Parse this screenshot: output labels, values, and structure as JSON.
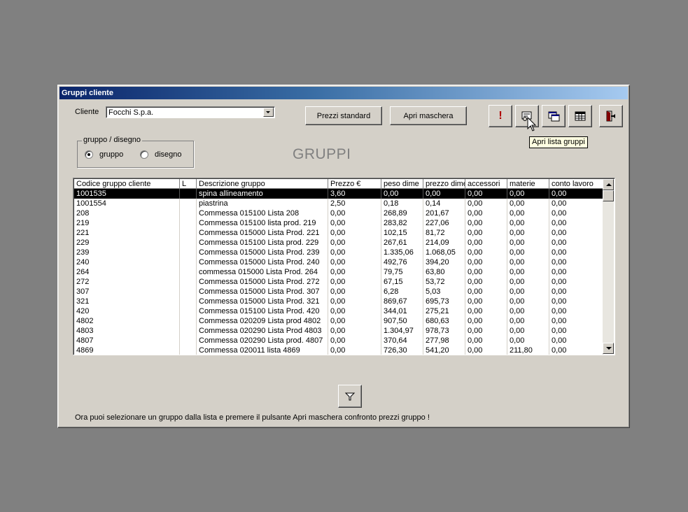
{
  "window": {
    "title": "Gruppi cliente"
  },
  "cliente": {
    "label": "Cliente",
    "value": "Focchi S.p.a."
  },
  "buttons": {
    "prezzi_standard": "Prezzi standard",
    "apri_maschera": "Apri maschera"
  },
  "toolbar": {
    "alert": {
      "icon": "exclamation-icon",
      "glyph": "!"
    },
    "open_groups": {
      "icon": "open-groups-icon"
    },
    "windows": {
      "icon": "windows-icon"
    },
    "table": {
      "icon": "table-icon"
    },
    "exit": {
      "icon": "exit-door-icon"
    }
  },
  "tooltip": "Apri lista gruppi",
  "group_option": {
    "legend": "gruppo / disegno",
    "options": [
      "gruppo",
      "disegno"
    ],
    "selected": "gruppo"
  },
  "heading": "GRUPPI",
  "table": {
    "columns": [
      "Codice gruppo cliente",
      "L",
      "Descrizione gruppo",
      "Prezzo €",
      "peso dime",
      "prezzo dime",
      "accessori",
      "materie",
      "conto lavoro"
    ],
    "selected_row": 0,
    "rows": [
      [
        "1001535",
        "",
        "spina allineamento",
        "3,60",
        "0,00",
        "0,00",
        "0,00",
        "0,00",
        "0,00"
      ],
      [
        "1001554",
        "",
        "piastrina",
        "2,50",
        "0,18",
        "0,14",
        "0,00",
        "0,00",
        "0,00"
      ],
      [
        "208",
        "",
        "Commessa 015100 Lista 208",
        "0,00",
        "268,89",
        "201,67",
        "0,00",
        "0,00",
        "0,00"
      ],
      [
        "219",
        "",
        "Commessa 015100 lista prod. 219",
        "0,00",
        "283,82",
        "227,06",
        "0,00",
        "0,00",
        "0,00"
      ],
      [
        "221",
        "",
        "Commessa 015000 Lista Prod. 221",
        "0,00",
        "102,15",
        "81,72",
        "0,00",
        "0,00",
        "0,00"
      ],
      [
        "229",
        "",
        "Commessa 015100 Lista prod. 229",
        "0,00",
        "267,61",
        "214,09",
        "0,00",
        "0,00",
        "0,00"
      ],
      [
        "239",
        "",
        "Commessa 015000 Lista Prod. 239",
        "0,00",
        "1.335,06",
        "1.068,05",
        "0,00",
        "0,00",
        "0,00"
      ],
      [
        "240",
        "",
        "Commessa 015000 Lista Prod. 240",
        "0,00",
        "492,76",
        "394,20",
        "0,00",
        "0,00",
        "0,00"
      ],
      [
        "264",
        "",
        "commessa 015000 Lista Prod. 264",
        "0,00",
        "79,75",
        "63,80",
        "0,00",
        "0,00",
        "0,00"
      ],
      [
        "272",
        "",
        "Commessa 015000 Lista Prod. 272",
        "0,00",
        "67,15",
        "53,72",
        "0,00",
        "0,00",
        "0,00"
      ],
      [
        "307",
        "",
        "Commessa 015000 Lista Prod. 307",
        "0,00",
        "6,28",
        "5,03",
        "0,00",
        "0,00",
        "0,00"
      ],
      [
        "321",
        "",
        "Commessa 015000 Lista Prod. 321",
        "0,00",
        "869,67",
        "695,73",
        "0,00",
        "0,00",
        "0,00"
      ],
      [
        "420",
        "",
        "Commessa 015100 Lista Prod. 420",
        "0,00",
        "344,01",
        "275,21",
        "0,00",
        "0,00",
        "0,00"
      ],
      [
        "4802",
        "",
        "Commessa 020209 Lista prod 4802",
        "0,00",
        "907,50",
        "680,63",
        "0,00",
        "0,00",
        "0,00"
      ],
      [
        "4803",
        "",
        "Commessa 020290 Lista Prod 4803",
        "0,00",
        "1.304,97",
        "978,73",
        "0,00",
        "0,00",
        "0,00"
      ],
      [
        "4807",
        "",
        "Commessa 020290 Lista prod. 4807",
        "0,00",
        "370,64",
        "277,98",
        "0,00",
        "0,00",
        "0,00"
      ],
      [
        "4869",
        "",
        "Commessa 020011 lista 4869",
        "0,00",
        "726,30",
        "541,20",
        "0,00",
        "211,80",
        "0,00"
      ]
    ]
  },
  "filter_button": {
    "icon": "filter-funnel-icon"
  },
  "status_text": "Ora puoi selezionare un gruppo dalla lista e premere il pulsante Apri maschera confronto prezzi gruppo !"
}
